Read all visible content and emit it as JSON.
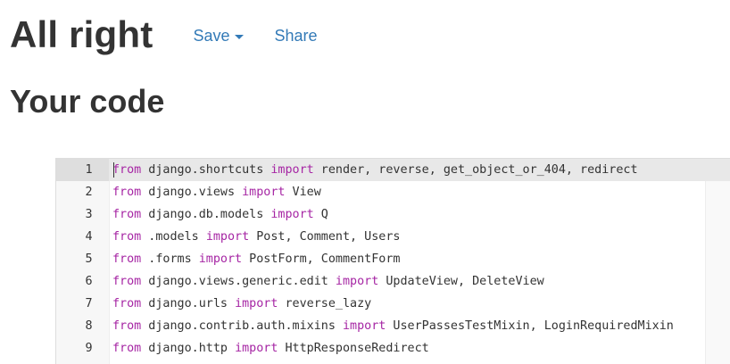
{
  "header": {
    "title": "All right",
    "save_label": "Save",
    "share_label": "Share"
  },
  "section": {
    "title": "Your code"
  },
  "editor": {
    "active_line": 1,
    "keyword_color": "#a626a4",
    "lines": [
      {
        "number": "1",
        "parts": [
          [
            "kw",
            "from"
          ],
          [
            "t",
            " django.shortcuts "
          ],
          [
            "kw",
            "import"
          ],
          [
            "t",
            " render, reverse, get_object_or_404, redirect"
          ]
        ]
      },
      {
        "number": "2",
        "parts": [
          [
            "kw",
            "from"
          ],
          [
            "t",
            " django.views "
          ],
          [
            "kw",
            "import"
          ],
          [
            "t",
            " View"
          ]
        ]
      },
      {
        "number": "3",
        "parts": [
          [
            "kw",
            "from"
          ],
          [
            "t",
            " django.db.models "
          ],
          [
            "kw",
            "import"
          ],
          [
            "t",
            " Q"
          ]
        ]
      },
      {
        "number": "4",
        "parts": [
          [
            "kw",
            "from"
          ],
          [
            "t",
            " .models "
          ],
          [
            "kw",
            "import"
          ],
          [
            "t",
            " Post, Comment, Users"
          ]
        ]
      },
      {
        "number": "5",
        "parts": [
          [
            "kw",
            "from"
          ],
          [
            "t",
            " .forms "
          ],
          [
            "kw",
            "import"
          ],
          [
            "t",
            " PostForm, CommentForm"
          ]
        ]
      },
      {
        "number": "6",
        "parts": [
          [
            "kw",
            "from"
          ],
          [
            "t",
            " django.views.generic.edit "
          ],
          [
            "kw",
            "import"
          ],
          [
            "t",
            " UpdateView, DeleteView"
          ]
        ]
      },
      {
        "number": "7",
        "parts": [
          [
            "kw",
            "from"
          ],
          [
            "t",
            " django.urls "
          ],
          [
            "kw",
            "import"
          ],
          [
            "t",
            " reverse_lazy"
          ]
        ]
      },
      {
        "number": "8",
        "parts": [
          [
            "kw",
            "from"
          ],
          [
            "t",
            " django.contrib.auth.mixins "
          ],
          [
            "kw",
            "import"
          ],
          [
            "t",
            " UserPassesTestMixin, LoginRequiredMixin"
          ]
        ]
      },
      {
        "number": "9",
        "parts": [
          [
            "kw",
            "from"
          ],
          [
            "t",
            " django.http "
          ],
          [
            "kw",
            "import"
          ],
          [
            "t",
            " HttpResponseRedirect"
          ]
        ]
      }
    ]
  }
}
